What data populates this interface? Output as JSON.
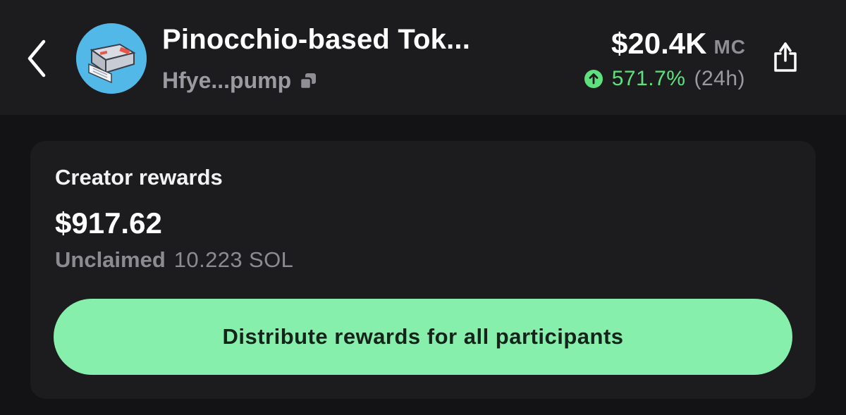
{
  "header": {
    "token_name": "Pinocchio-based Tok...",
    "token_address": "Hfye...pump",
    "market_cap_value": "$20.4K",
    "market_cap_label": "MC",
    "change_percent": "571.7%",
    "change_period": "(24h)"
  },
  "rewards_card": {
    "title": "Creator rewards",
    "amount": "$917.62",
    "unclaimed_label": "Unclaimed",
    "unclaimed_value": "10.223 SOL",
    "distribute_button_label": "Distribute rewards for all participants"
  },
  "icons": {
    "back": "chevron-left-icon",
    "token_avatar": "laminator-machine-image",
    "copy": "copy-icon",
    "change_direction": "arrow-up-circle-icon",
    "share": "share-icon"
  },
  "colors": {
    "background": "#131316",
    "header_background": "#1c1c1e",
    "card_background": "#1c1c1f",
    "positive": "#5ee07f",
    "button": "#86efac",
    "button_text": "#14241a",
    "secondary_text": "#9a9aa0",
    "avatar_background": "#52b8e8"
  }
}
